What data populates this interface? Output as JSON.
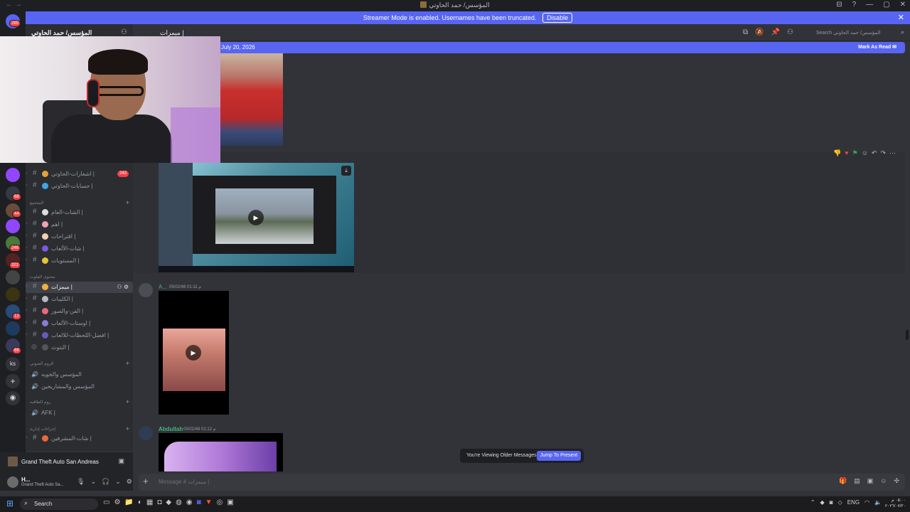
{
  "window": {
    "title": "المؤسس/ حمد الحاوتي",
    "controls": [
      "⊟",
      "?",
      "—",
      "▢",
      "✕"
    ]
  },
  "banner": {
    "text": "Streamer Mode is enabled. Usernames have been truncated.",
    "disable_label": "Disable",
    "close_glyph": "✕"
  },
  "guilds": {
    "home_badge": "285",
    "badges": [
      "68",
      "44",
      "246",
      "322",
      "12",
      "66"
    ],
    "ks_label": "ks"
  },
  "server": {
    "name": "المؤسس/ حمد الحاوتي",
    "channels": [
      {
        "name": "اشعارات-الحاوتي |",
        "count": "243"
      },
      {
        "name": "حسابات-الحاوتي |"
      },
      {
        "category": "المجتمع"
      },
      {
        "name": "الشات-العام |"
      },
      {
        "name": "اهم |"
      },
      {
        "name": "اقتراحات |"
      },
      {
        "name": "شات-الألعاب |"
      },
      {
        "name": "المستويات |"
      },
      {
        "category": "محتوى الفلوت"
      },
      {
        "name": "ميمزات |",
        "selected": true
      },
      {
        "name": "الكليبات |"
      },
      {
        "name": "الفن-والصور |"
      },
      {
        "name": "اوستات-الألعاب |"
      },
      {
        "name": "افضل-اللحظات-للالعاب |"
      },
      {
        "name": "البثوث |"
      }
    ],
    "voice_category": "الروم الصوتي",
    "voice_channels": [
      "المؤسس والخويه",
      "المؤسس والمشاريخين"
    ],
    "afk_category": "روم الطافيه",
    "afk_channel": "AFK |",
    "admin_category": "إجراءات إدارية",
    "admin_channel": "شات-المشرفين |"
  },
  "activity": {
    "game": "Grand Theft Auto San Andreas"
  },
  "user": {
    "name": "H...",
    "status": "Grand Theft Auto Sa..."
  },
  "chat": {
    "channel": "ميمزات |",
    "search_placeholder": "Search المؤسس/ حمد الحاوتي",
    "new_since": "July 20, 2026",
    "mark_as_read": "Mark As Read",
    "msg2": {
      "name": "A...",
      "time": "05/02/48 01:11 م"
    },
    "msg3": {
      "name": "Abdullah",
      "time": "05/02/48 01:12 م"
    },
    "older_text": "You're Viewing Older Messages",
    "jump_label": "Jump To Present",
    "composer_placeholder": "Message # ميمزات |"
  },
  "taskbar": {
    "search": "Search",
    "lang": "ENG",
    "time": "٠٥:٠٠ م",
    "date": "٢٠٢٦/٠٧/٢٠"
  },
  "colors": {
    "accent": "#5865f2",
    "online": "#43b581",
    "badge": "#f23f43"
  }
}
